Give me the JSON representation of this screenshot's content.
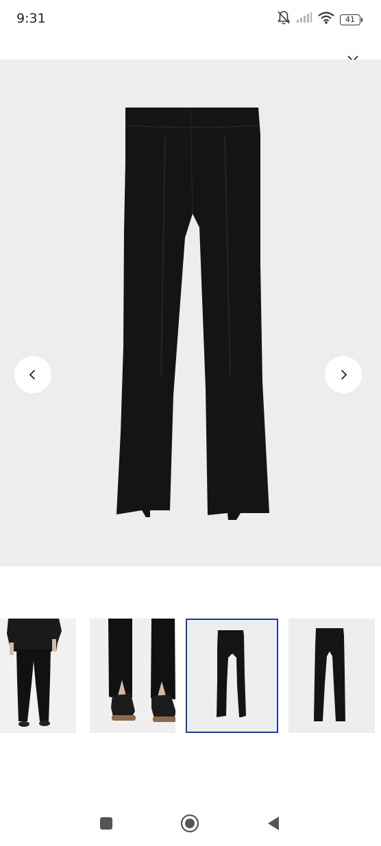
{
  "status_bar": {
    "time": "9:31",
    "battery_level": "41",
    "icons": [
      "bell-off-icon",
      "signal-icon",
      "wifi-icon",
      "battery-icon"
    ]
  },
  "viewer": {
    "close_icon": "close-icon",
    "prev_icon": "chevron-left-icon",
    "next_icon": "chevron-right-icon",
    "main_image": "black-split-hem-flare-trousers-flat-lay",
    "background_color": "#ededee"
  },
  "thumbnails": [
    {
      "name": "model-back-view",
      "active": false
    },
    {
      "name": "split-hem-detail-with-sneakers",
      "active": false
    },
    {
      "name": "flat-lay-front",
      "active": true
    },
    {
      "name": "flat-lay-back",
      "active": false
    }
  ],
  "colors": {
    "active_border": "#1a3f8f",
    "garment": "#151414"
  },
  "system_nav": [
    "recent-apps-icon",
    "home-icon",
    "back-icon"
  ]
}
